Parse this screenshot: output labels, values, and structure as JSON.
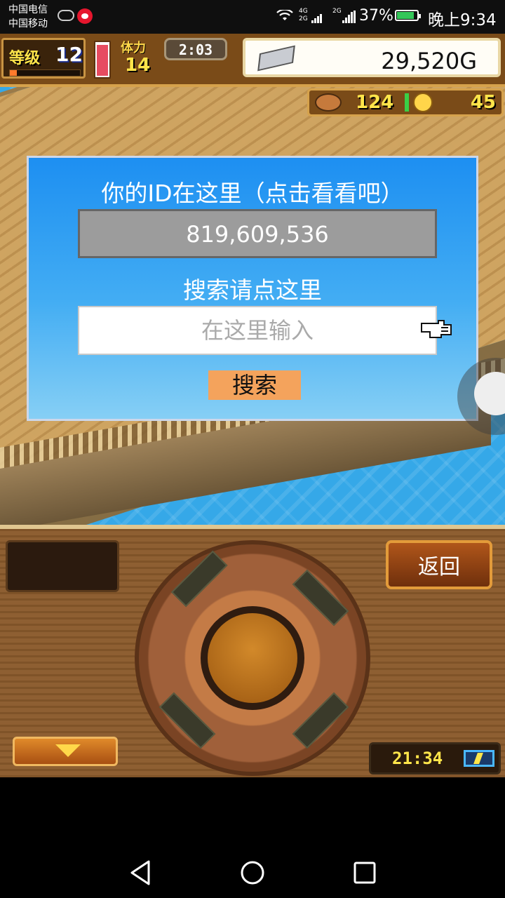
{
  "status_bar": {
    "carrier_1": "中国电信",
    "carrier_2": "中国移动",
    "net_1": "4G",
    "net_2": "2G",
    "net_3": "2G",
    "battery_percent": "37%",
    "time": "晚上9:34",
    "icons": [
      "weather-icon",
      "weibo-icon",
      "wifi-icon",
      "signal-icon",
      "battery-icon"
    ]
  },
  "hud": {
    "level_label": "等级",
    "level_value": "12",
    "level_progress": 0.1,
    "stamina_level": 0.95,
    "stamina_label": "体力",
    "stamina_value": "14",
    "timer": "2:03",
    "money": "29,520G",
    "resource_1_value": "124",
    "resource_2_value": "45"
  },
  "dialog": {
    "title": "你的ID在这里（点击看看吧）",
    "id_value": "819,609,536",
    "search_title": "搜索请点这里",
    "search_placeholder": "在这里输入",
    "search_button": "搜索"
  },
  "controller": {
    "back_button": "返回",
    "clock": "21:34"
  },
  "colors": {
    "dialog_blue": "#1d8ff2",
    "button_orange": "#f4a35c",
    "hud_gold": "#ffe54a",
    "sea": "#35a8e8",
    "wood": "#8a5a2b"
  }
}
